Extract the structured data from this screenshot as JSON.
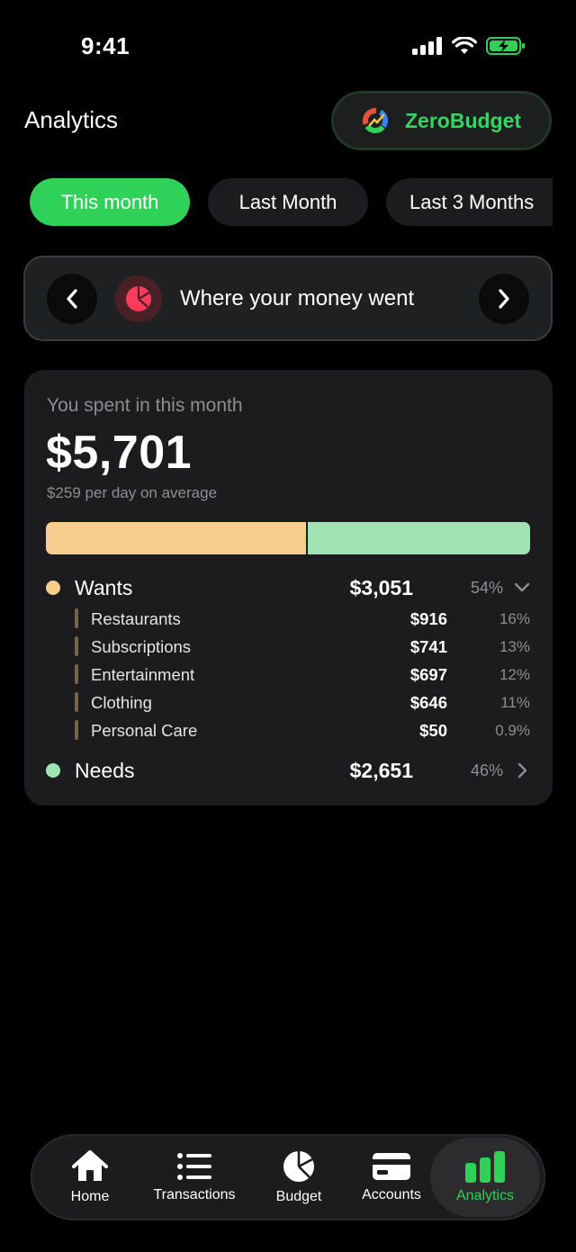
{
  "status_bar": {
    "time": "9:41"
  },
  "header": {
    "title": "Analytics",
    "brand": "ZeroBudget"
  },
  "period_tabs": [
    {
      "label": "This month",
      "active": true
    },
    {
      "label": "Last Month",
      "active": false
    },
    {
      "label": "Last 3 Months",
      "active": false
    }
  ],
  "insight_nav": {
    "title": "Where your money went"
  },
  "spending": {
    "label": "You spent in this month",
    "amount": "$5,701",
    "sub": "$259 per day on average",
    "split": [
      {
        "name": "Wants",
        "share": 0.54,
        "color": "#f7cd8d"
      },
      {
        "name": "Needs",
        "share": 0.46,
        "color": "#a1e3b3"
      }
    ],
    "groups": [
      {
        "name": "Wants",
        "amount": "$3,051",
        "percent": "54%",
        "color": "#f7cd8d",
        "expanded": true,
        "items": [
          {
            "name": "Restaurants",
            "amount": "$916",
            "percent": "16%"
          },
          {
            "name": "Subscriptions",
            "amount": "$741",
            "percent": "13%"
          },
          {
            "name": "Entertainment",
            "amount": "$697",
            "percent": "12%"
          },
          {
            "name": "Clothing",
            "amount": "$646",
            "percent": "11%"
          },
          {
            "name": "Personal Care",
            "amount": "$50",
            "percent": "0.9%"
          }
        ]
      },
      {
        "name": "Needs",
        "amount": "$2,651",
        "percent": "46%",
        "color": "#a1e3b3",
        "expanded": false,
        "items": []
      }
    ]
  },
  "tabbar": [
    {
      "label": "Home",
      "icon": "home-icon",
      "active": false
    },
    {
      "label": "Transactions",
      "icon": "list-icon",
      "active": false
    },
    {
      "label": "Budget",
      "icon": "pie-chart-icon",
      "active": false
    },
    {
      "label": "Accounts",
      "icon": "credit-card-icon",
      "active": false
    },
    {
      "label": "Analytics",
      "icon": "bar-chart-icon",
      "active": true
    }
  ],
  "colors": {
    "accent": "#30d158",
    "background": "#000000",
    "card": "#1c1c1e",
    "insight_icon": "#ff3b5c"
  }
}
